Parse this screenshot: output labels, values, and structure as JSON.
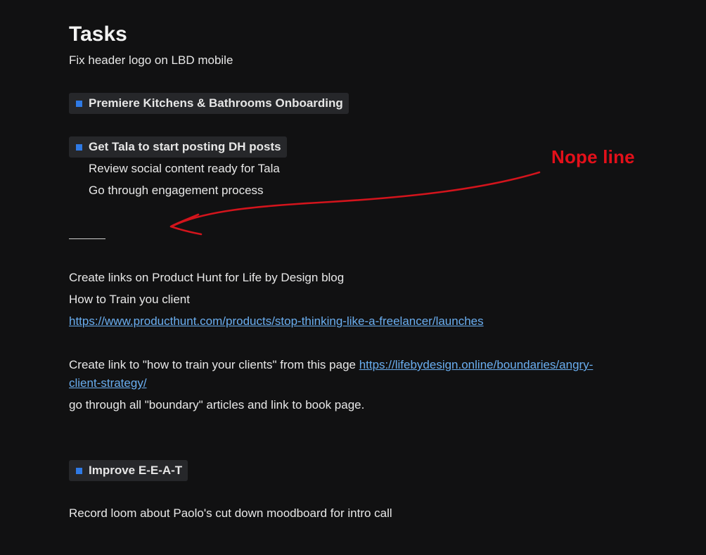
{
  "page": {
    "title": "Tasks",
    "items": {
      "fix_header": "Fix header logo on LBD mobile",
      "premiere_chip": "Premiere Kitchens & Bathrooms Onboarding",
      "tala_chip": "Get Tala to start posting DH posts",
      "tala_sub1": "Review social content ready for Tala",
      "tala_sub2": "Go through engagement process",
      "producthunt_links": "Create links on Product Hunt for Life by Design blog",
      "train_client": "How to Train you client",
      "producthunt_url": "https://www.producthunt.com/products/stop-thinking-like-a-freelancer/launches",
      "create_link_text": "Create link to \"how to train your clients\" from this page ",
      "angry_client_url_part1": "https://lifebydesign.online/boundaries/angry-",
      "angry_client_url_part2": "client-strategy/",
      "boundary_articles": "go through all \"boundary\" articles and link to book page.",
      "eeat_chip": "Improve E-E-A-T",
      "record_loom": "Record loom about Paolo's cut down moodboard for intro call"
    },
    "annotation": {
      "label": "Nope line",
      "color": "#e3101a"
    },
    "colors": {
      "background": "#111112",
      "chip_background": "#26272a",
      "chip_square": "#2f7ae5",
      "link": "#6aaef0"
    }
  }
}
